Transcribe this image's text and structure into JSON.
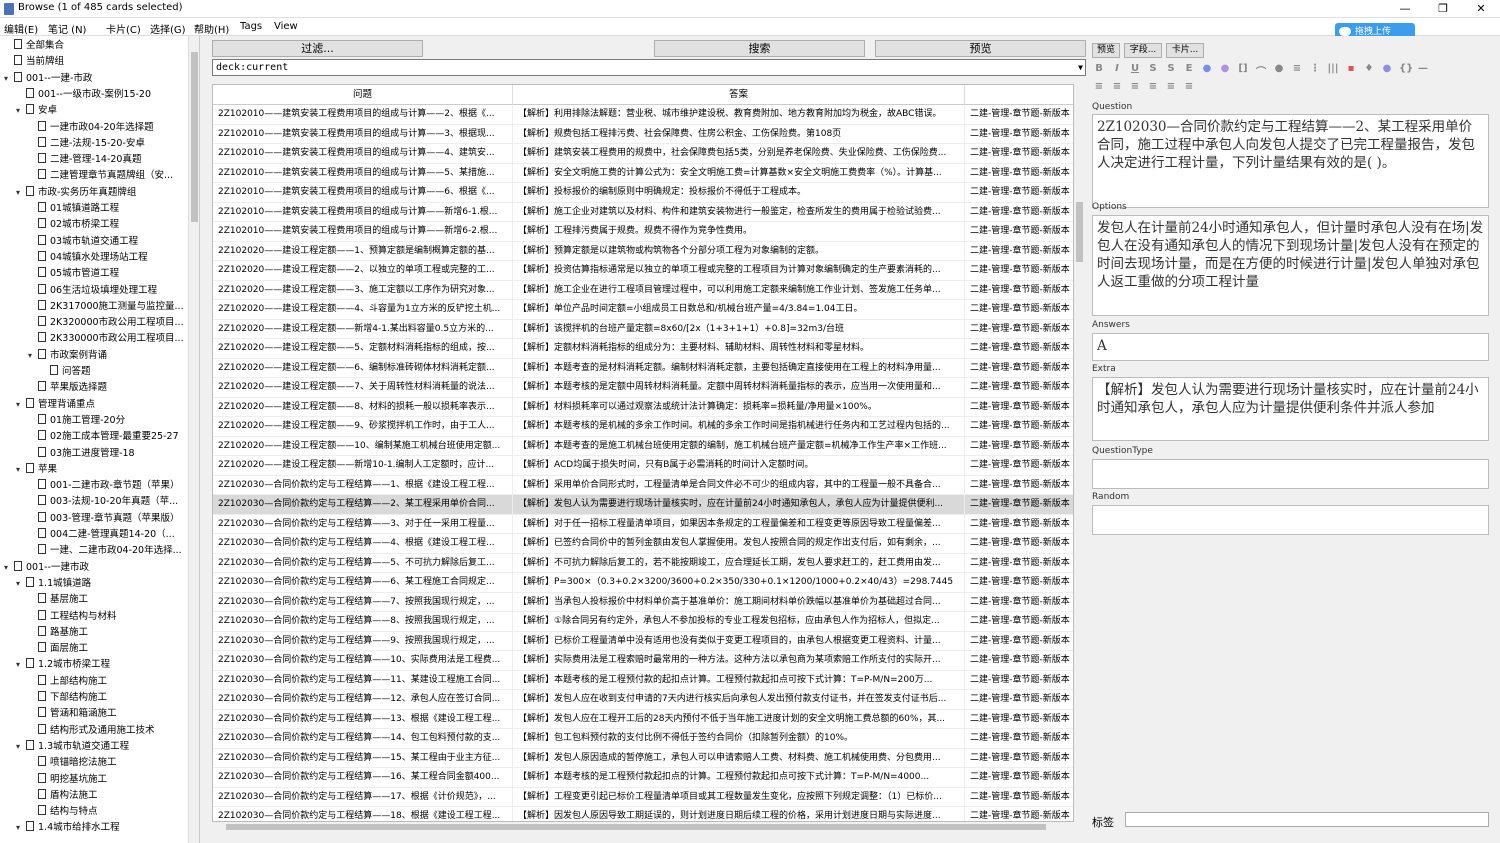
{
  "window": {
    "title": "Browse (1 of 485 cards selected)",
    "minimize": "—",
    "restore": "❐",
    "close": "✕"
  },
  "upload": {
    "label": "拖拽上传"
  },
  "menu": [
    "编辑(E)",
    "笔记 (N)",
    "卡片(C)",
    "选择(G)",
    "帮助(H)",
    "Tags",
    "View"
  ],
  "sidebar": {
    "items": [
      {
        "label": "全部集合",
        "depth": 0,
        "arrow": "",
        "icon": "cards"
      },
      {
        "label": "当前牌组",
        "depth": 0,
        "arrow": "",
        "icon": "deck"
      },
      {
        "label": "001--一建-市政",
        "depth": 0,
        "arrow": "▾",
        "icon": "deck"
      },
      {
        "label": "001--一级市政-案例15-20",
        "depth": 1,
        "arrow": "",
        "icon": "deck"
      },
      {
        "label": "安卓",
        "depth": 1,
        "arrow": "▾",
        "icon": "deck"
      },
      {
        "label": "一建市政04-20年选择题",
        "depth": 2,
        "arrow": "",
        "icon": "deck"
      },
      {
        "label": "二建-法规-15-20-安卓",
        "depth": 2,
        "arrow": "",
        "icon": "deck"
      },
      {
        "label": "二建-管理-14-20真题",
        "depth": 2,
        "arrow": "",
        "icon": "deck"
      },
      {
        "label": "二建管理章节真题牌组（安...",
        "depth": 2,
        "arrow": "",
        "icon": "deck"
      },
      {
        "label": "市政-实务历年真题牌组",
        "depth": 1,
        "arrow": "▾",
        "icon": "deck"
      },
      {
        "label": "01城镇道路工程",
        "depth": 2,
        "arrow": "",
        "icon": "deck"
      },
      {
        "label": "02城市桥梁工程",
        "depth": 2,
        "arrow": "",
        "icon": "deck"
      },
      {
        "label": "03城市轨道交通工程",
        "depth": 2,
        "arrow": "",
        "icon": "deck"
      },
      {
        "label": "04城镇水处理场站工程",
        "depth": 2,
        "arrow": "",
        "icon": "deck"
      },
      {
        "label": "05城市管道工程",
        "depth": 2,
        "arrow": "",
        "icon": "deck"
      },
      {
        "label": "06生活垃圾填埋处理工程",
        "depth": 2,
        "arrow": "",
        "icon": "deck"
      },
      {
        "label": "2K317000施工测量与监控量...",
        "depth": 2,
        "arrow": "",
        "icon": "deck"
      },
      {
        "label": "2K320000市政公用工程项目...",
        "depth": 2,
        "arrow": "",
        "icon": "deck"
      },
      {
        "label": "2K330000市政公用工程项目...",
        "depth": 2,
        "arrow": "",
        "icon": "deck"
      },
      {
        "label": "市政案例背诵",
        "depth": 2,
        "arrow": "▾",
        "icon": "deck"
      },
      {
        "label": "问答题",
        "depth": 3,
        "arrow": "",
        "icon": "deck"
      },
      {
        "label": "苹果版选择题",
        "depth": 2,
        "arrow": "",
        "icon": "deck"
      },
      {
        "label": "管理背诵重点",
        "depth": 1,
        "arrow": "▾",
        "icon": "deck"
      },
      {
        "label": "01施工管理-20分",
        "depth": 2,
        "arrow": "",
        "icon": "deck"
      },
      {
        "label": "02施工成本管理-最重要25-27",
        "depth": 2,
        "arrow": "",
        "icon": "deck"
      },
      {
        "label": "03施工进度管理-18",
        "depth": 2,
        "arrow": "",
        "icon": "deck"
      },
      {
        "label": "苹果",
        "depth": 1,
        "arrow": "▾",
        "icon": "deck"
      },
      {
        "label": "001-二建市政-章节题（苹果）",
        "depth": 2,
        "arrow": "",
        "icon": "deck"
      },
      {
        "label": "003-法规-10-20年真题（苹...",
        "depth": 2,
        "arrow": "",
        "icon": "deck"
      },
      {
        "label": "003-管理-章节真题（苹果版）",
        "depth": 2,
        "arrow": "",
        "icon": "deck"
      },
      {
        "label": "004二建-管理真题14-20（...",
        "depth": 2,
        "arrow": "",
        "icon": "deck"
      },
      {
        "label": "一建、二建市政04-20年选择...",
        "depth": 2,
        "arrow": "",
        "icon": "deck"
      },
      {
        "label": "001--一建市政",
        "depth": 0,
        "arrow": "▾",
        "icon": "deck"
      },
      {
        "label": "1.1城镇道路",
        "depth": 1,
        "arrow": "▾",
        "icon": "deck"
      },
      {
        "label": "基层施工",
        "depth": 2,
        "arrow": "",
        "icon": "deck"
      },
      {
        "label": "工程结构与材料",
        "depth": 2,
        "arrow": "",
        "icon": "deck"
      },
      {
        "label": "路基施工",
        "depth": 2,
        "arrow": "",
        "icon": "deck"
      },
      {
        "label": "面层施工",
        "depth": 2,
        "arrow": "",
        "icon": "deck"
      },
      {
        "label": "1.2城市桥梁工程",
        "depth": 1,
        "arrow": "▾",
        "icon": "deck"
      },
      {
        "label": "上部结构施工",
        "depth": 2,
        "arrow": "",
        "icon": "deck"
      },
      {
        "label": "下部结构施工",
        "depth": 2,
        "arrow": "",
        "icon": "deck"
      },
      {
        "label": "管涵和箱涵施工",
        "depth": 2,
        "arrow": "",
        "icon": "deck"
      },
      {
        "label": "结构形式及通用施工技术",
        "depth": 2,
        "arrow": "",
        "icon": "deck"
      },
      {
        "label": "1.3城市轨道交通工程",
        "depth": 1,
        "arrow": "▾",
        "icon": "deck"
      },
      {
        "label": "喷锚暗挖法施工",
        "depth": 2,
        "arrow": "",
        "icon": "deck"
      },
      {
        "label": "明挖基坑施工",
        "depth": 2,
        "arrow": "",
        "icon": "deck"
      },
      {
        "label": "盾构法施工",
        "depth": 2,
        "arrow": "",
        "icon": "deck"
      },
      {
        "label": "结构与特点",
        "depth": 2,
        "arrow": "",
        "icon": "deck"
      },
      {
        "label": "1.4城市给排水工程",
        "depth": 1,
        "arrow": "▾",
        "icon": "deck"
      }
    ]
  },
  "toolbar": {
    "filter": "过滤...",
    "search": "搜索",
    "preview": "预览"
  },
  "search": {
    "value": "deck:current"
  },
  "table": {
    "columns": [
      "问题",
      "答案",
      ""
    ],
    "selected_index": 20,
    "rows": [
      [
        "2Z102010——建筑安装工程费用项目的组成与计算——2、根据《...",
        "【解析】利用排除法解题：营业税、城市维护建设税、教育费附加、地方教育附加均为税金，故ABC错误。",
        "二建-管理-章节题-新版本"
      ],
      [
        "2Z102010——建筑安装工程费用项目的组成与计算——3、根据现...",
        "【解析】规费包括工程排污费、社会保障费、住房公积金、工伤保险费。第108页",
        "二建-管理-章节题-新版本"
      ],
      [
        "2Z102010——建筑安装工程费用项目的组成与计算——4、建筑安...",
        "【解析】建筑安装工程费用的规费中，社会保障费包括5类，分别是养老保险费、失业保险费、工伤保险费...",
        "二建-管理-章节题-新版本"
      ],
      [
        "2Z102010——建筑安装工程费用项目的组成与计算——5、某措施...",
        "【解析】安全文明施工费的计算公式为：安全文明施工费=计算基数×安全文明施工费费率（%）。计算基...",
        "二建-管理-章节题-新版本"
      ],
      [
        "2Z102010——建筑安装工程费用项目的组成与计算——6、根据《...",
        "【解析】投标报价的编制原则中明确规定：投标报价不得低于工程成本。",
        "二建-管理-章节题-新版本"
      ],
      [
        "2Z102010——建筑安装工程费用项目的组成与计算——新增6-1.根...",
        "【解析】施工企业对建筑以及材料、构件和建筑安装物进行一般鉴定，检查所发生的费用属于检验试验费...",
        "二建-管理-章节题-新版本"
      ],
      [
        "2Z102010——建筑安装工程费用项目的组成与计算——新增6-2.根...",
        "【解析】工程排污费属于规费。规费不得作为竞争性费用。",
        "二建-管理-章节题-新版本"
      ],
      [
        "2Z102020——建设工程定额——1、预算定额是编制概算定额的基...",
        "【解析】预算定额是以建筑物或构筑物各个分部分项工程为对象编制的定额。",
        "二建-管理-章节题-新版本"
      ],
      [
        "2Z102020——建设工程定额——2、以独立的单项工程或完整的工...",
        "【解析】投资估算指标通常是以独立的单项工程或完整的工程项目为计算对象编制确定的生产要素消耗的...",
        "二建-管理-章节题-新版本"
      ],
      [
        "2Z102020——建设工程定额——3、施工定额以工序作为研究对象...",
        "【解析】施工企业在进行工程项目管理过程中，可以利用施工定额来编制施工作业计划、签发施工任务单...",
        "二建-管理-章节题-新版本"
      ],
      [
        "2Z102020——建设工程定额——4、斗容量为1立方米的反铲挖土机...",
        "【解析】单位产品时间定额=小组成员工日数总和/机械台班产量=4/3.84=1.04工日。",
        "二建-管理-章节题-新版本"
      ],
      [
        "2Z102020——建设工程定额——新增4-1.某出料容量0.5立方米的...",
        "【解析】该搅拌机的台班产量定额=8x60/[2x（1+3+1+1）+0.8]=32m3/台班",
        "二建-管理-章节题-新版本"
      ],
      [
        "2Z102020——建设工程定额——5、定额材料消耗指标的组成，按...",
        "【解析】定额材料消耗指标的组成分为：主要材料、辅助材料、周转性材料和零星材料。",
        "二建-管理-章节题-新版本"
      ],
      [
        "2Z102020——建设工程定额——6、编制标准砖砌体材料消耗定额...",
        "【解析】本题考查的是材料消耗定额。编制材料消耗定额，主要包括确定直接使用在工程上的材料净用量...",
        "二建-管理-章节题-新版本"
      ],
      [
        "2Z102020——建设工程定额——7、关于周转性材料消耗量的说法...",
        "【解析】本题考核的是定额中周转材料消耗量。定额中周转材料消耗量指标的表示，应当用一次使用量和...",
        "二建-管理-章节题-新版本"
      ],
      [
        "2Z102020——建设工程定额——8、材料的损耗一般以损耗率表示...",
        "【解析】材料损耗率可以通过观察法或统计法计算确定：损耗率=损耗量/净用量×100%。",
        "二建-管理-章节题-新版本"
      ],
      [
        "2Z102020——建设工程定额——9、砂浆搅拌机工作时，由于工人...",
        "【解析】本题考核的是机械的多余工作时间。机械的多余工作时间是指机械进行任务内和工艺过程内包括的...",
        "二建-管理-章节题-新版本"
      ],
      [
        "2Z102020——建设工程定额——10、编制某施工机械台班使用定额...",
        "【解析】本题考查的是施工机械台班使用定额的编制，施工机械台班产量定额=机械净工作生产率×工作班...",
        "二建-管理-章节题-新版本"
      ],
      [
        "2Z102020——建设工程定额——新增10-1.编制人工定额时，应计...",
        "【解析】ACD均属于损失时间，只有B属于必需消耗的时间计入定额时间。",
        "二建-管理-章节题-新版本"
      ],
      [
        "2Z102030—合同价款约定与工程结算——1、根据《建设工程工程...",
        "【解析】采用单价合同形式时，工程量清单是合同文件必不可少的组成内容，其中的工程量一般不具备合...",
        "二建-管理-章节题-新版本"
      ],
      [
        "2Z102030—合同价款约定与工程结算——2、某工程采用单价合同...",
        "【解析】发包人认为需要进行现场计量核实时，应在计量前24小时通知承包人，承包人应为计量提供便利...",
        "二建-管理-章节题-新版本"
      ],
      [
        "2Z102030—合同价款约定与工程结算——3、对于任一采用工程量...",
        "【解析】对于任一招标工程量清单项目，如果因本条规定的工程量偏差和工程变更等原因导致工程量偏差...",
        "二建-管理-章节题-新版本"
      ],
      [
        "2Z102030—合同价款约定与工程结算——4、根据《建设工程工程...",
        "【解析】已签约合同价中的暂列金额由发包人掌握使用。发包人按照合同的规定作出支付后，如有剩余，...",
        "二建-管理-章节题-新版本"
      ],
      [
        "2Z102030—合同价款约定与工程结算——5、不可抗力解除后复工...",
        "【解析】不可抗力解除后复工的，若不能按期竣工，应合理延长工期，发包人要求赶工的，赶工费用由发...",
        "二建-管理-章节题-新版本"
      ],
      [
        "2Z102030—合同价款约定与工程结算——6、某工程施工合同规定...",
        "【解析】P=300×（0.3+0.2×3200/3600+0.2×350/330+0.1×1200/1000+0.2×40/43）=298.7445",
        "二建-管理-章节题-新版本"
      ],
      [
        "2Z102030—合同价款约定与工程结算——7、按照我国现行规定，...",
        "【解析】当承包人投标报价中材料单价高于基准单价：施工期间材料单价跌幅以基准单价为基础超过合同...",
        "二建-管理-章节题-新版本"
      ],
      [
        "2Z102030—合同价款约定与工程结算——8、按照我国现行规定，...",
        "【解析】①除合同另有约定外，承包人不参加投标的专业工程发包招标，应由承包人作为招标人，但拟定...",
        "二建-管理-章节题-新版本"
      ],
      [
        "2Z102030—合同价款约定与工程结算——9、按照我国现行规定，...",
        "【解析】已标价工程量清单中没有适用也没有类似于变更工程项目的，由承包人根据变更工程资料、计量...",
        "二建-管理-章节题-新版本"
      ],
      [
        "2Z102030—合同价款约定与工程结算——10、实际费用法是工程费...",
        "【解析】实际费用法是工程索赔时最常用的一种方法。这种方法以承包商为某项索赔工作所支付的实际开...",
        "二建-管理-章节题-新版本"
      ],
      [
        "2Z102030—合同价款约定与工程结算——11、某建设工程施工合同...",
        "【解析】本题考核的是工程预付款的起扣点计算。工程预付款起扣点可按下式计算：T=P-M/N=200万...",
        "二建-管理-章节题-新版本"
      ],
      [
        "2Z102030—合同价款约定与工程结算——12、承包人应在签订合同...",
        "【解析】发包人应在收到支付申请的7天内进行核实后向承包人发出预付款支付证书，并在签发支付证书后...",
        "二建-管理-章节题-新版本"
      ],
      [
        "2Z102030—合同价款约定与工程结算——13、根据《建设工程工程...",
        "【解析】发包人应在工程开工后的28天内预付不低于当年施工进度计划的安全文明施工费总额的60%，其...",
        "二建-管理-章节题-新版本"
      ],
      [
        "2Z102030—合同价款约定与工程结算——14、包工包料预付款的支...",
        "【解析】包工包料预付款的支付比例不得低于签约合同价（扣除暂列金额）的10%。",
        "二建-管理-章节题-新版本"
      ],
      [
        "2Z102030—合同价款约定与工程结算——15、某工程由于业主方征...",
        "【解析】发包人原因造成的暂停施工，承包人可以申请索赔人工费、材料费、施工机械使用费、分包费用...",
        "二建-管理-章节题-新版本"
      ],
      [
        "2Z102030—合同价款约定与工程结算——16、某工程合同金额400...",
        "【解析】本题考核的是工程预付款起扣点的计算。工程预付款起扣点可按下式计算：T=P-M/N=4000...",
        "二建-管理-章节题-新版本"
      ],
      [
        "2Z102030—合同价款约定与工程结算——17、根据《计价规范》，...",
        "【解析】工程变更引起已标价工程量清单项目或其工程数量发生变化，应按照下列规定调整：（1）已标价...",
        "二建-管理-章节题-新版本"
      ],
      [
        "2Z102030—合同价款约定与工程结算——18、根据《建设工程工程...",
        "【解析】因发包人原因导致工期延误的，则计划进度日期后续工程的价格，采用计划进度日期与实际进度...",
        "二建-管理-章节题-新版本"
      ]
    ]
  },
  "editor": {
    "buttons": {
      "preview": "预览",
      "fields": "字段...",
      "cards": "卡片..."
    },
    "fields": [
      {
        "name": "Question",
        "value": "2Z102030—合同价款约定与工程结算——2、某工程采用单价合同，施工过程中承包人向发包人提交了已完工程量报告，发包人决定进行工程计量，下列计量结果有效的是( )。"
      },
      {
        "name": "Options",
        "value": "发包人在计量前24小时通知承包人，但计量时承包人没有在场|发包人在没有通知承包人的情况下到现场计量|发包人没有在预定的时间去现场计量，而是在方便的时候进行计量|发包人单独对承包人返工重做的分项工程计量"
      },
      {
        "name": "Answers",
        "value": "A"
      },
      {
        "name": "Extra",
        "value": "【解析】发包人认为需要进行现场计量核实时，应在计量前24小时通知承包人，承包人应为计量提供便利条件并派人参加"
      },
      {
        "name": "QuestionType",
        "value": ""
      },
      {
        "name": "Random",
        "value": ""
      }
    ],
    "tags_label": "标签"
  },
  "colors": {
    "selected_row": "#d9d9d9",
    "upload_button": "#3b9cf0"
  }
}
